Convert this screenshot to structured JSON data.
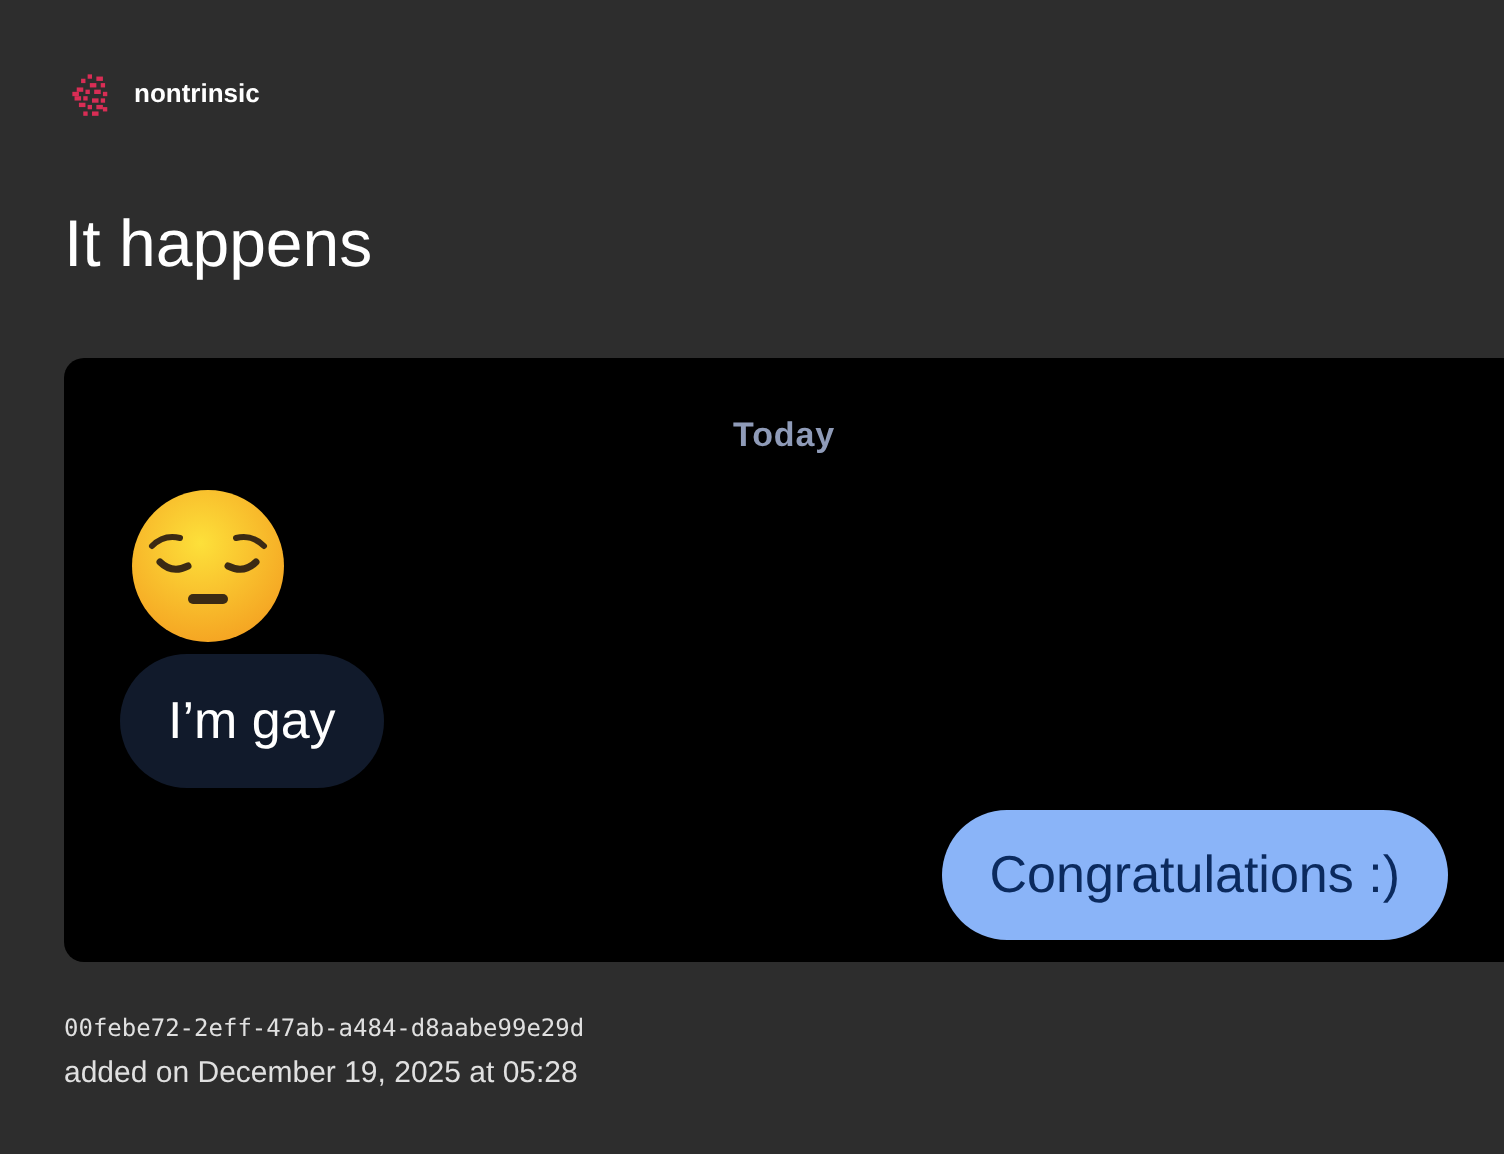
{
  "site": {
    "name": "nontrinsic"
  },
  "post": {
    "title": "It happens",
    "chat": {
      "date_label": "Today",
      "messages": [
        {
          "kind": "emoji"
        },
        {
          "kind": "received",
          "text": "I’m gay"
        },
        {
          "kind": "sent",
          "text": "Congratulations :)"
        }
      ]
    },
    "id": "00febe72-2eff-47ab-a484-d8aabe99e29d",
    "added": "added on December 19, 2025 at 05:28"
  }
}
